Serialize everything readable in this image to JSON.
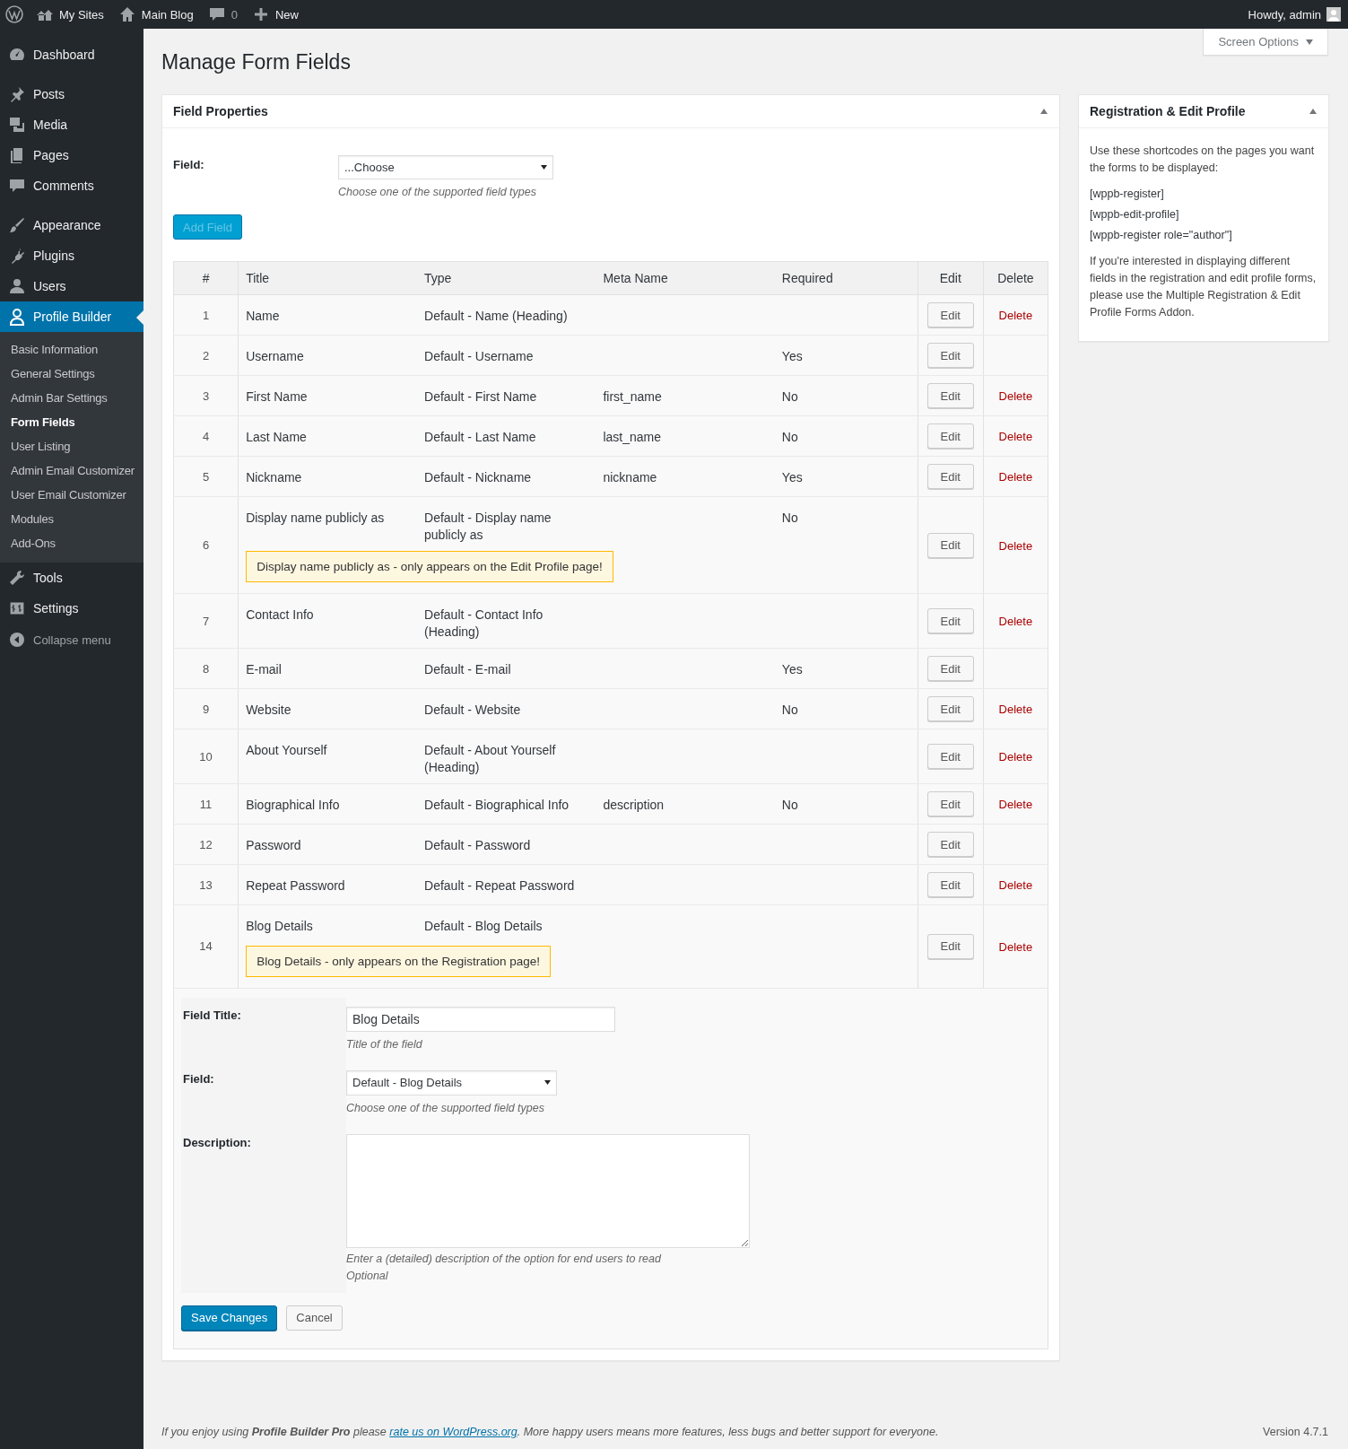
{
  "admin_bar": {
    "items": [
      {
        "label": "My Sites"
      },
      {
        "label": "Main Blog"
      },
      {
        "label": "0"
      },
      {
        "label": "New"
      }
    ],
    "greeting": "Howdy, admin"
  },
  "sidebar": {
    "items": [
      {
        "label": "Dashboard",
        "selected": false
      },
      {
        "label": "Posts",
        "selected": false
      },
      {
        "label": "Media",
        "selected": false
      },
      {
        "label": "Pages",
        "selected": false
      },
      {
        "label": "Comments",
        "selected": false
      },
      {
        "label": "Appearance",
        "selected": false
      },
      {
        "label": "Plugins",
        "selected": false
      },
      {
        "label": "Users",
        "selected": false
      },
      {
        "label": "Profile Builder",
        "selected": true,
        "children": [
          {
            "label": "Basic Information",
            "selected": false
          },
          {
            "label": "General Settings",
            "selected": false
          },
          {
            "label": "Admin Bar Settings",
            "selected": false
          },
          {
            "label": "Form Fields",
            "selected": true
          },
          {
            "label": "User Listing",
            "selected": false
          },
          {
            "label": "Admin Email Customizer",
            "selected": false
          },
          {
            "label": "User Email Customizer",
            "selected": false
          },
          {
            "label": "Modules",
            "selected": false
          },
          {
            "label": "Add-Ons",
            "selected": false
          }
        ]
      },
      {
        "label": "Tools",
        "selected": false
      },
      {
        "label": "Settings",
        "selected": false
      }
    ],
    "collapse": "Collapse menu"
  },
  "screen_options": "Screen Options",
  "page_title": "Manage Form Fields",
  "field_properties": {
    "title": "Field Properties",
    "field_label": "Field:",
    "select_value": "...Choose",
    "hint": "Choose one of the supported field types",
    "add_button": {
      "label": "Add Field",
      "disabled": true
    }
  },
  "table": {
    "columns": [
      "#",
      "Title",
      "Type",
      "Meta Name",
      "Required",
      "Edit",
      "Delete"
    ],
    "rows": [
      {
        "number": "1",
        "title": "Name",
        "type": "Default - Name (Heading)",
        "edit": "Edit",
        "delete": "Delete"
      },
      {
        "number": "2",
        "title": "Username",
        "type": "Default - Username",
        "required": "Yes",
        "edit": "Edit"
      },
      {
        "number": "3",
        "title": "First Name",
        "type": "Default - First Name",
        "meta": "first_name",
        "required": "No",
        "edit": "Edit",
        "delete": "Delete"
      },
      {
        "number": "4",
        "title": "Last Name",
        "type": "Default - Last Name",
        "meta": "last_name",
        "required": "No",
        "edit": "Edit",
        "delete": "Delete"
      },
      {
        "number": "5",
        "title": "Nickname",
        "type": "Default - Nickname",
        "meta": "nickname",
        "required": "Yes",
        "edit": "Edit",
        "delete": "Delete"
      },
      {
        "number": "6",
        "title": "Display name publicly as",
        "type": "Default - Display name publicly as",
        "required": "No",
        "notice": "Display name publicly as - only appears on the Edit Profile page!",
        "edit": "Edit",
        "delete": "Delete"
      },
      {
        "number": "7",
        "title": "Contact Info",
        "type": "Default - Contact Info (Heading)",
        "edit": "Edit",
        "delete": "Delete"
      },
      {
        "number": "8",
        "title": "E-mail",
        "type": "Default - E-mail",
        "required": "Yes",
        "edit": "Edit"
      },
      {
        "number": "9",
        "title": "Website",
        "type": "Default - Website",
        "required": "No",
        "edit": "Edit",
        "delete": "Delete"
      },
      {
        "number": "10",
        "title": "About Yourself",
        "type": "Default - About Yourself (Heading)",
        "edit": "Edit",
        "delete": "Delete"
      },
      {
        "number": "11",
        "title": "Biographical Info",
        "type": "Default - Biographical Info",
        "meta": "description",
        "required": "No",
        "edit": "Edit",
        "delete": "Delete"
      },
      {
        "number": "12",
        "title": "Password",
        "type": "Default - Password",
        "edit": "Edit"
      },
      {
        "number": "13",
        "title": "Repeat Password",
        "type": "Default - Repeat Password",
        "edit": "Edit",
        "delete": "Delete"
      },
      {
        "number": "14",
        "title": "Blog Details",
        "type": "Default - Blog Details",
        "notice": "Blog Details - only appears on the Registration page!",
        "edit": "Edit",
        "delete": "Delete"
      }
    ]
  },
  "edit_form": {
    "title_label": "Field Title:",
    "title_value": "Blog Details",
    "title_hint": "Title of the field",
    "field_label": "Field:",
    "field_value": "Default - Blog Details",
    "field_hint": "Choose one of the supported field types",
    "description_label": "Description:",
    "description_hints": [
      "Enter a (detailed) description of the option for end users to read",
      "Optional"
    ],
    "save": "Save Changes",
    "cancel": "Cancel"
  },
  "side_box": {
    "title": "Registration & Edit Profile",
    "intro": "Use these shortcodes on the pages you want the forms to be displayed:",
    "shortcodes": [
      "[wppb-register]",
      "[wppb-edit-profile]",
      "[wppb-register role=\"author\"]"
    ],
    "note": "If you're interested in displaying different fields in the registration and edit profile forms, please use the Multiple Registration & Edit Profile Forms Addon."
  },
  "footer": {
    "before": "If you enjoy using **Profile Builder Pro** please",
    "link": "rate us on WordPress.org",
    "after": ". More happy users means more features, less bugs and better support for everyone.",
    "version": "Version 4.7.1"
  }
}
